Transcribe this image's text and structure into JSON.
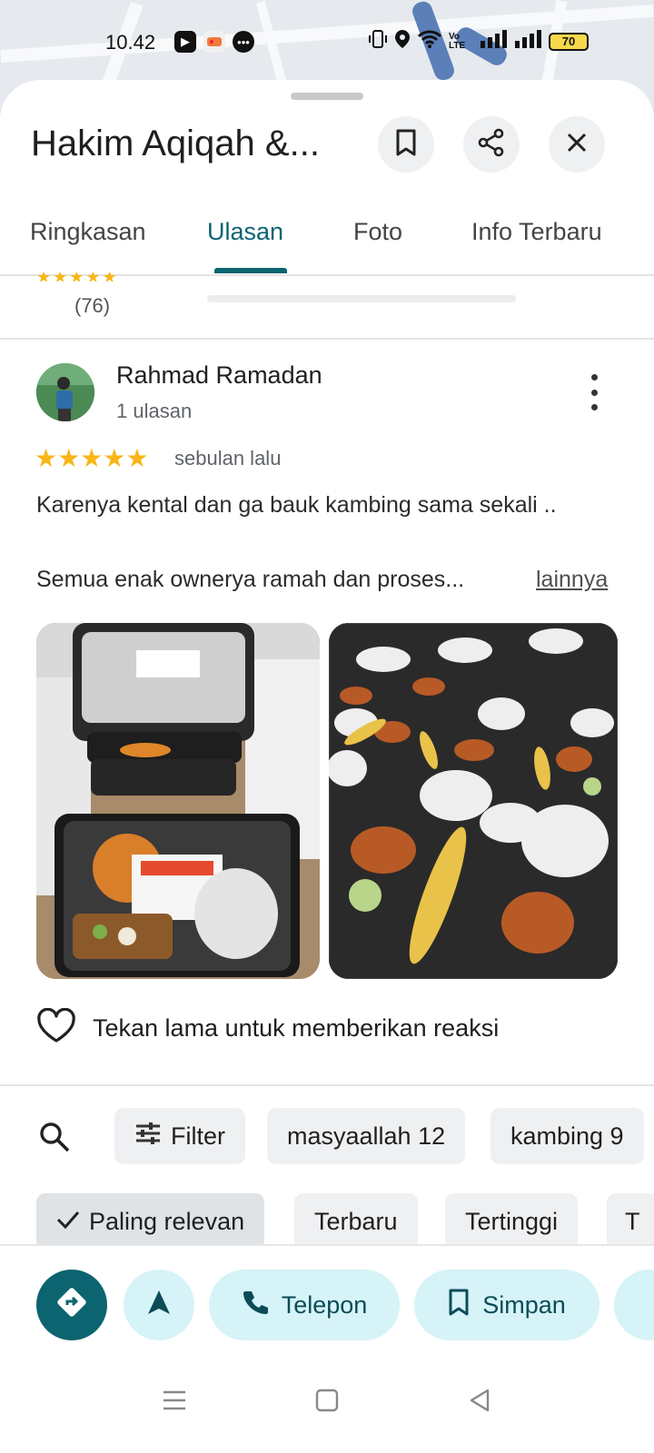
{
  "status_bar": {
    "time": "10.42",
    "battery": "70",
    "network": "Vo LTE"
  },
  "place": {
    "title": "Hakim Aqiqah &..."
  },
  "header_icons": [
    "bookmark-icon",
    "share-icon",
    "close-icon"
  ],
  "tabs": [
    {
      "label": "Ringkasan",
      "active": false
    },
    {
      "label": "Ulasan",
      "active": true
    },
    {
      "label": "Foto",
      "active": false
    },
    {
      "label": "Info Terbaru",
      "active": false
    }
  ],
  "rating_summary": {
    "count": "(76)"
  },
  "review": {
    "name": "Rahmad Ramadan",
    "reviews_count": "1 ulasan",
    "stars": "★★★★★",
    "time": "sebulan lalu",
    "text": "Karenya kental dan ga bauk kambing sama sekali ..",
    "text_line2": "Semua enak ownerya ramah dan proses...",
    "more_link": "lainnya",
    "photos": [
      "photo-aqiqah-box",
      "photo-food-trays"
    ],
    "reaction_hint": "Tekan lama untuk memberikan reaksi"
  },
  "filters": {
    "filter_label": "Filter",
    "chips": [
      "masyaallah 12",
      "kambing 9"
    ],
    "sort": [
      "Paling relevan",
      "Terbaru",
      "Tertinggi",
      "T"
    ]
  },
  "actions": {
    "call": "Telepon",
    "save": "Simpan"
  },
  "colors": {
    "accent": "#0b6470",
    "star": "#f9b616",
    "action_bg": "#d6f3f8"
  }
}
